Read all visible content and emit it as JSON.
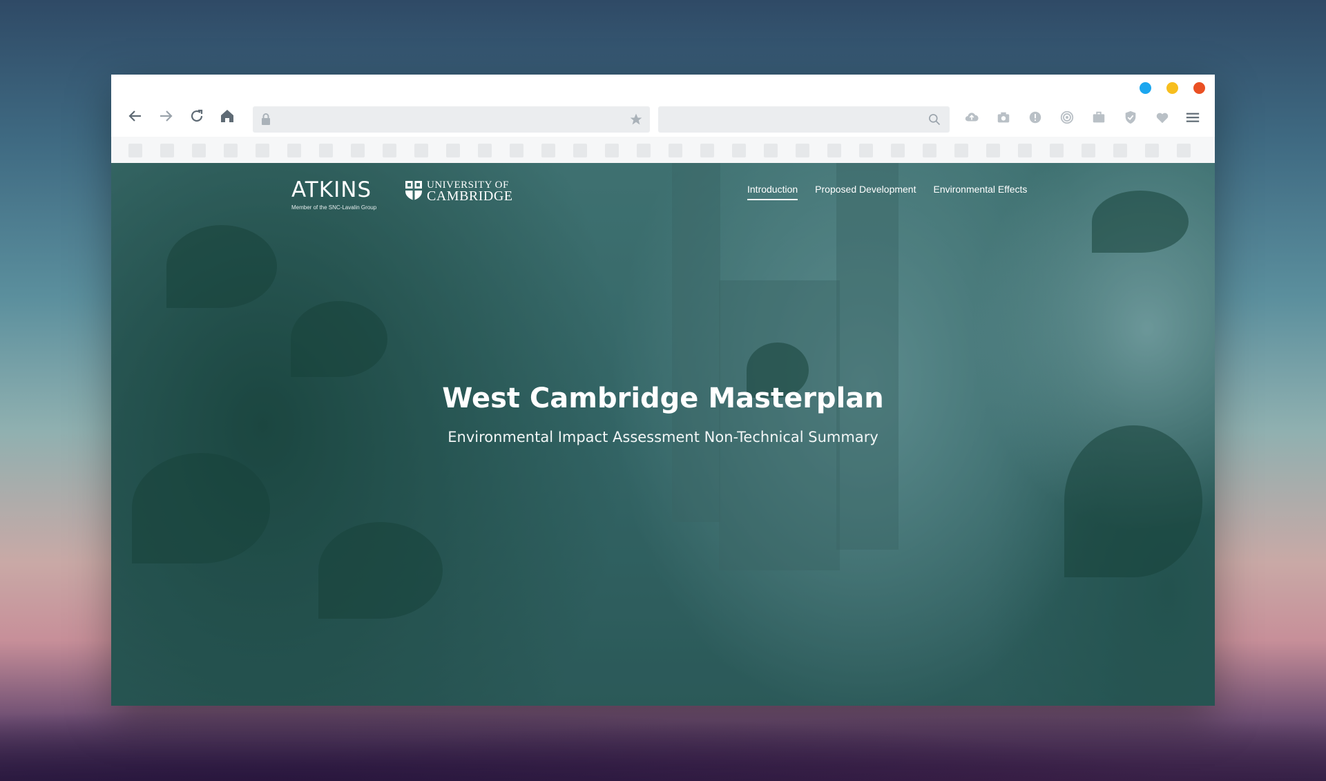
{
  "browser": {
    "window_controls": {
      "colors": [
        "#1ba6ef",
        "#f7be1e",
        "#ea5023"
      ]
    },
    "toolbar": {
      "back_icon": "arrow-left-icon",
      "forward_icon": "arrow-right-icon",
      "reload_icon": "reload-icon",
      "home_icon": "home-icon",
      "url_value": "",
      "search_value": "",
      "extensions": [
        "cloud-upload-icon",
        "camera-icon",
        "alert-icon",
        "broadcast-icon",
        "briefcase-icon",
        "shield-check-icon",
        "heart-icon",
        "menu-icon"
      ]
    }
  },
  "site": {
    "logos": {
      "atkins": "ATKINS",
      "atkins_sub": "Member of the SNC-Lavalin Group",
      "cambridge_line1": "UNIVERSITY OF",
      "cambridge_line2": "CAMBRIDGE"
    },
    "nav": {
      "items": [
        {
          "label": "Introduction",
          "active": true
        },
        {
          "label": "Proposed Development",
          "active": false
        },
        {
          "label": "Environmental Effects",
          "active": false
        }
      ]
    },
    "hero": {
      "title": "West Cambridge Masterplan",
      "subtitle": "Environmental Impact Assessment Non-Technical Summary"
    }
  },
  "colors": {
    "accent_overlay": "#2f6464",
    "text": "#ffffff"
  }
}
